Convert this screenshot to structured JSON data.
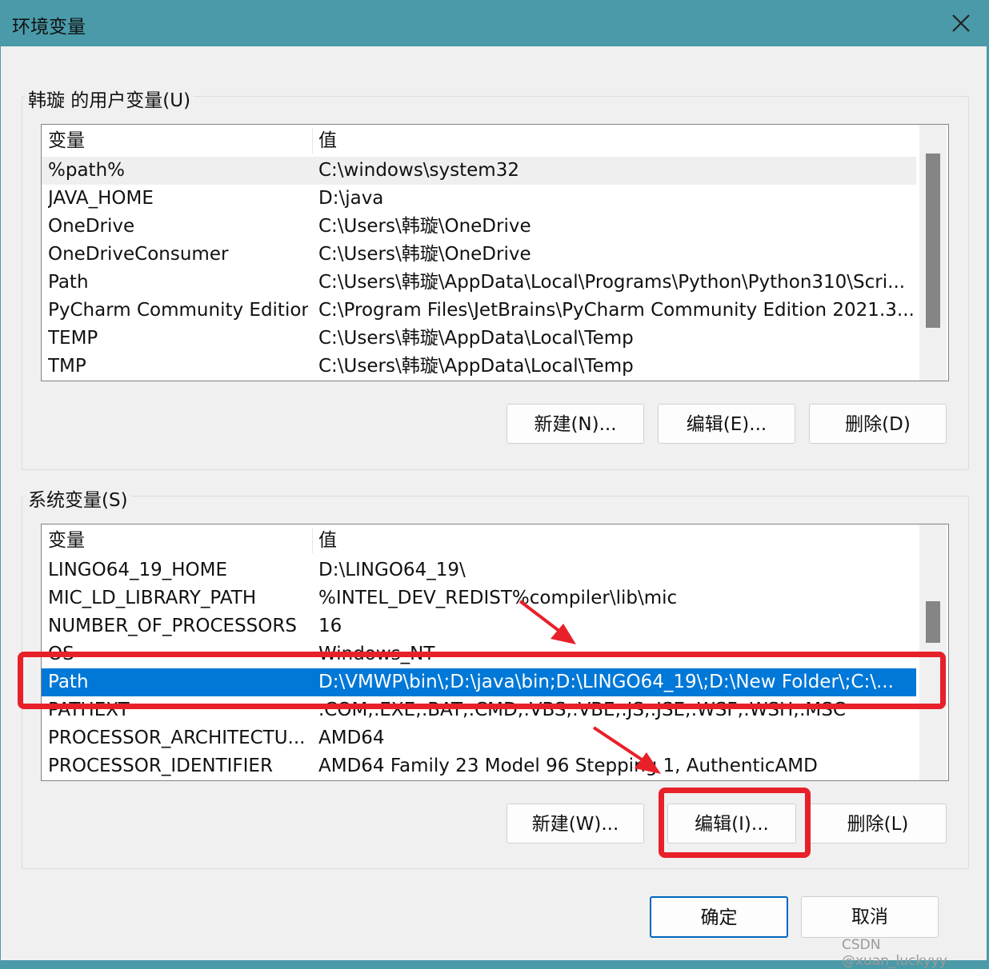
{
  "window": {
    "title": "环境变量",
    "close_label": "close"
  },
  "user_section": {
    "label": "韩璇 的用户变量(U)",
    "columns": [
      "变量",
      "值"
    ],
    "rows": [
      [
        "%path%",
        "C:\\windows\\system32"
      ],
      [
        "JAVA_HOME",
        "D:\\java"
      ],
      [
        "OneDrive",
        "C:\\Users\\韩璇\\OneDrive"
      ],
      [
        "OneDriveConsumer",
        "C:\\Users\\韩璇\\OneDrive"
      ],
      [
        "Path",
        "C:\\Users\\韩璇\\AppData\\Local\\Programs\\Python\\Python310\\Scri..."
      ],
      [
        "PyCharm Community Edition",
        "C:\\Program Files\\JetBrains\\PyCharm Community Edition 2021.3...."
      ],
      [
        "TEMP",
        "C:\\Users\\韩璇\\AppData\\Local\\Temp"
      ],
      [
        "TMP",
        "C:\\Users\\韩璇\\AppData\\Local\\Temp"
      ]
    ],
    "buttons": {
      "new": "新建(N)...",
      "edit": "编辑(E)...",
      "delete": "删除(D)"
    }
  },
  "system_section": {
    "label": "系统变量(S)",
    "columns": [
      "变量",
      "值"
    ],
    "rows": [
      [
        "LINGO64_19_HOME",
        "D:\\LINGO64_19\\"
      ],
      [
        "MIC_LD_LIBRARY_PATH",
        "%INTEL_DEV_REDIST%compiler\\lib\\mic"
      ],
      [
        "NUMBER_OF_PROCESSORS",
        "16"
      ],
      [
        "OS",
        "Windows_NT"
      ],
      [
        "Path",
        "D:\\VMWP\\bin\\;D:\\java\\bin;D:\\LINGO64_19\\;D:\\New Folder\\;C:\\..."
      ],
      [
        "PATHEXT",
        ".COM;.EXE;.BAT;.CMD;.VBS;.VBE;.JS;.JSE;.WSF;.WSH;.MSC"
      ],
      [
        "PROCESSOR_ARCHITECTU...",
        "AMD64"
      ],
      [
        "PROCESSOR_IDENTIFIER",
        "AMD64 Family 23 Model 96 Stepping 1, AuthenticAMD"
      ]
    ],
    "selected_row": "Path",
    "buttons": {
      "new": "新建(W)...",
      "edit": "编辑(I)...",
      "delete": "删除(L)"
    }
  },
  "footer": {
    "ok": "确定",
    "cancel": "取消"
  },
  "watermark": "CSDN @xuan_luckyyy",
  "colors": {
    "titlebar": "#4a9aa9",
    "selection": "#0078d7",
    "highlight_annotation": "#e8202a"
  }
}
